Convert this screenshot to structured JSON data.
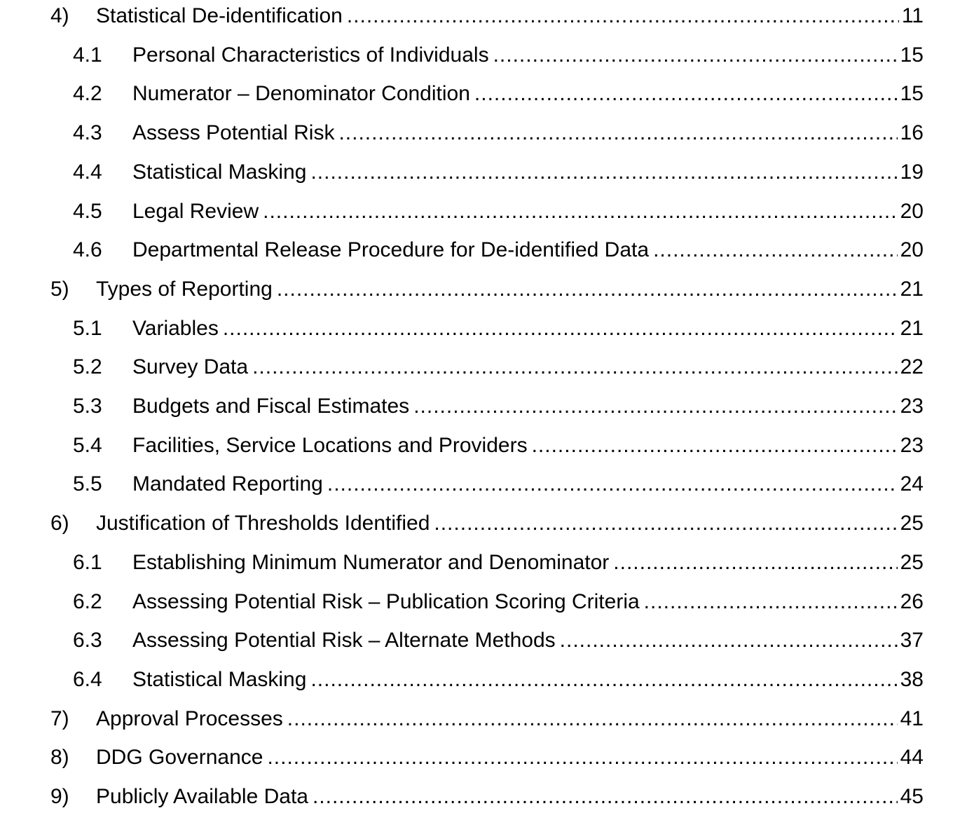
{
  "toc": {
    "entries": [
      {
        "number": "4)",
        "title": "Statistical De-identification",
        "page": "11",
        "level": 1
      },
      {
        "number": "4.1",
        "title": "Personal Characteristics of Individuals",
        "page": "15",
        "level": 2
      },
      {
        "number": "4.2",
        "title": "Numerator – Denominator Condition",
        "page": "15",
        "level": 2
      },
      {
        "number": "4.3",
        "title": "Assess Potential Risk",
        "page": "16",
        "level": 2
      },
      {
        "number": "4.4",
        "title": "Statistical Masking",
        "page": "19",
        "level": 2
      },
      {
        "number": "4.5",
        "title": "Legal Review",
        "page": "20",
        "level": 2
      },
      {
        "number": "4.6",
        "title": "Departmental Release Procedure for De-identified Data",
        "page": "20",
        "level": 2
      },
      {
        "number": "5)",
        "title": "Types of Reporting",
        "page": "21",
        "level": 1
      },
      {
        "number": "5.1",
        "title": "Variables",
        "page": "21",
        "level": 2
      },
      {
        "number": "5.2",
        "title": "Survey Data",
        "page": "22",
        "level": 2
      },
      {
        "number": "5.3",
        "title": "Budgets and Fiscal Estimates",
        "page": "23",
        "level": 2
      },
      {
        "number": "5.4",
        "title": "Facilities, Service Locations and Providers",
        "page": "23",
        "level": 2
      },
      {
        "number": "5.5",
        "title": "Mandated Reporting",
        "page": "24",
        "level": 2
      },
      {
        "number": "6)",
        "title": "Justification of Thresholds Identified",
        "page": "25",
        "level": 1
      },
      {
        "number": "6.1",
        "title": "Establishing Minimum Numerator and Denominator",
        "page": "25",
        "level": 2
      },
      {
        "number": "6.2",
        "title": "Assessing Potential Risk – Publication Scoring Criteria",
        "page": "26",
        "level": 2
      },
      {
        "number": "6.3",
        "title": "Assessing Potential Risk – Alternate Methods",
        "page": "37",
        "level": 2
      },
      {
        "number": "6.4",
        "title": "Statistical Masking",
        "page": "38",
        "level": 2
      },
      {
        "number": "7)",
        "title": "Approval Processes",
        "page": "41",
        "level": 1
      },
      {
        "number": "8)",
        "title": "DDG Governance",
        "page": "44",
        "level": 1
      },
      {
        "number": "9)",
        "title": "Publicly Available Data",
        "page": "45",
        "level": 1
      }
    ]
  }
}
